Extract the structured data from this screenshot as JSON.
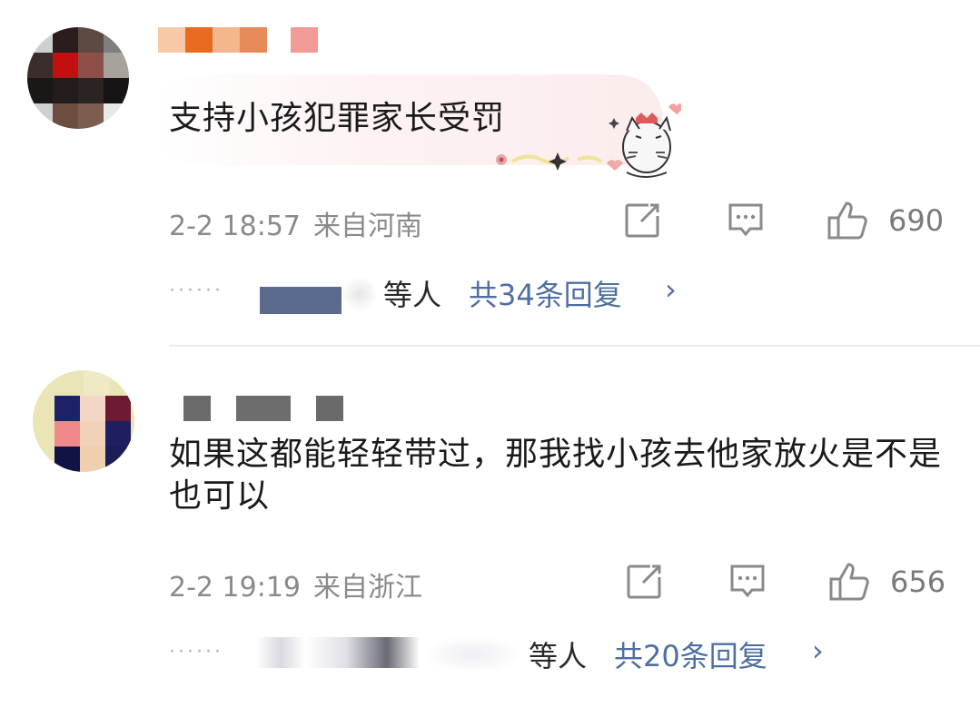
{
  "comments": [
    {
      "text": "支持小孩犯罪家长受罚",
      "date": "2-2 18:57",
      "location": "来自河南",
      "likes": "690",
      "reply_suffix": "等人",
      "reply_total": "共34条回复",
      "chevron": "›"
    },
    {
      "text": "如果这都能轻轻带过，那我找小孩去他家放火是不是也可以",
      "date": "2-2 19:19",
      "location": "来自浙江",
      "likes": "656",
      "reply_suffix": "等人",
      "reply_total": "共20条回复",
      "chevron": "›"
    }
  ],
  "icons": {
    "share": "share-icon",
    "comment": "comment-icon",
    "like": "thumbs-up-icon"
  },
  "colors": {
    "link": "#4e6fa1",
    "meta": "#8a8a8a",
    "text": "#1a1a1a"
  }
}
